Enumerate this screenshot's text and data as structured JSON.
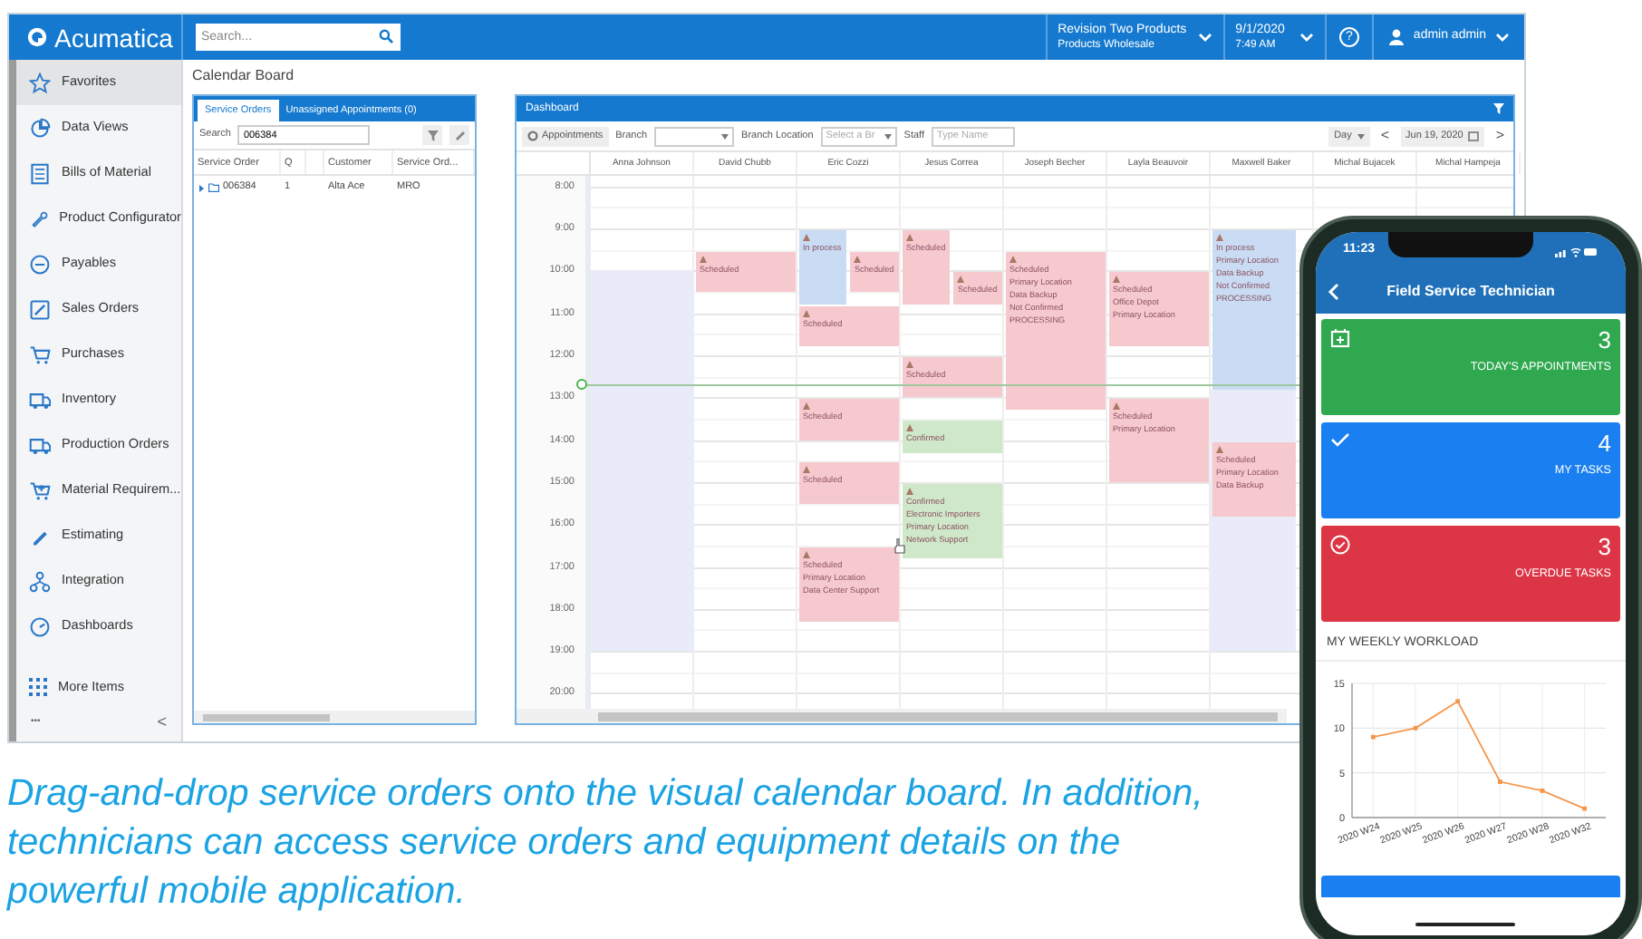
{
  "top_bar": {
    "logo": "Acumatica",
    "search": {
      "placeholder": "Search..."
    },
    "company": {
      "line1": "Revision Two Products",
      "line2": "Products Wholesale"
    },
    "date": {
      "line1": "9/1/2020",
      "line2": "7:49 AM"
    },
    "help": "?",
    "user": "admin admin"
  },
  "sidebar": {
    "items": [
      {
        "label": "Favorites",
        "selected": true
      },
      {
        "label": "Data Views",
        "selected": false
      },
      {
        "label": "Bills of Material",
        "selected": false
      },
      {
        "label": "Product Configurator",
        "selected": false
      },
      {
        "label": "Payables",
        "selected": false
      },
      {
        "label": "Sales Orders",
        "selected": false
      },
      {
        "label": "Purchases",
        "selected": false
      },
      {
        "label": "Inventory",
        "selected": false
      },
      {
        "label": "Production Orders",
        "selected": false
      },
      {
        "label": "Material Requirem...",
        "selected": false
      },
      {
        "label": "Estimating",
        "selected": false
      },
      {
        "label": "Integration",
        "selected": false
      },
      {
        "label": "Dashboards",
        "selected": false
      }
    ],
    "more": "More Items",
    "dots": "•••",
    "collapse": "<"
  },
  "page_title": "Calendar Board",
  "orders_panel": {
    "tabs": [
      {
        "label": "Service Orders",
        "selected": true
      },
      {
        "label": "Unassigned Appointments (0)",
        "selected": false
      }
    ],
    "search_label": "Search",
    "search_value": "006384",
    "columns": [
      "Service Order",
      "Q",
      "",
      "Customer",
      "Service Ord..."
    ],
    "rows": [
      {
        "cells": [
          "006384",
          "1",
          "",
          "Alta Ace",
          "MRO"
        ],
        "expanded": false
      }
    ]
  },
  "calendar": {
    "title": "Dashboard",
    "toolbar": {
      "appointments": "Appointments",
      "branch_label": "Branch",
      "branch_location_label": "Branch Location",
      "branch_location_placeholder": "Select a Br",
      "staff_label": "Staff",
      "staff_placeholder": "Type Name",
      "view": "Day",
      "prev": "<",
      "date": "Jun 19, 2020",
      "next": ">"
    },
    "hours": [
      "8:00",
      "9:00",
      "10:00",
      "11:00",
      "12:00",
      "13:00",
      "14:00",
      "15:00",
      "16:00",
      "17:00",
      "18:00",
      "19:00",
      "20:00"
    ],
    "staff": [
      {
        "name": "Anna Johnson"
      },
      {
        "name": "David Chubb",
        "appointments": [
          {
            "color": "#f6c9cf",
            "lines": [
              "Scheduled"
            ]
          }
        ]
      },
      {
        "name": "Eric Cozzi",
        "appointments": [
          {
            "color": "#c9dcf3",
            "lines": [
              "In process"
            ]
          },
          {
            "color": "#f6c9cf",
            "lines": [
              "Scheduled"
            ]
          },
          {
            "color": "#f6c9cf",
            "lines": [
              "Scheduled"
            ]
          },
          {
            "color": "#f6c9cf",
            "lines": [
              "Scheduled"
            ]
          },
          {
            "color": "#f6c9cf",
            "lines": [
              "Scheduled"
            ]
          },
          {
            "color": "#f6c9cf",
            "lines": [
              "Scheduled",
              "Primary Location",
              "Data Center Support"
            ]
          }
        ]
      },
      {
        "name": "Jesus Correa",
        "appointments": [
          {
            "color": "#f6c9cf",
            "lines": [
              "Scheduled"
            ]
          },
          {
            "color": "#f6c9cf",
            "lines": [
              "Scheduled"
            ]
          },
          {
            "color": "#f6c9cf",
            "lines": [
              "Scheduled"
            ]
          },
          {
            "color": "#cfe8c9",
            "lines": [
              "Confirmed"
            ]
          },
          {
            "color": "#cfe8c9",
            "lines": [
              "Confirmed",
              "Electronic Importers",
              "Primary Location",
              "Network Support"
            ]
          }
        ]
      },
      {
        "name": "Joseph Becher",
        "appointments": [
          {
            "color": "#f6c9cf",
            "lines": [
              "Scheduled",
              "Primary Location",
              "Data Backup",
              "Not Confirmed",
              "PROCESSING"
            ]
          }
        ]
      },
      {
        "name": "Layla Beauvoir",
        "appointments": [
          {
            "color": "#f6c9cf",
            "lines": [
              "Scheduled",
              "Office Depot",
              "Primary Location"
            ]
          },
          {
            "color": "#f6c9cf",
            "lines": [
              "Scheduled",
              "Primary Location"
            ]
          }
        ]
      },
      {
        "name": "Maxwell Baker",
        "appointments": [
          {
            "color": "#c9dcf3",
            "lines": [
              "In process",
              "Primary Location",
              "Data Backup",
              "Not Confirmed",
              "PROCESSING"
            ]
          },
          {
            "color": "#f6c9cf",
            "lines": [
              "Scheduled",
              "Primary Location",
              "Data Backup"
            ]
          }
        ]
      },
      {
        "name": "Michal Bujacek"
      },
      {
        "name": "Michal Hampeja"
      }
    ]
  },
  "phone": {
    "time": "11:23",
    "title": "Field Service Technician",
    "tiles": [
      {
        "count": "3",
        "label": "TODAY'S APPOINTMENTS",
        "color": "#2fa84f",
        "kind": "calendar"
      },
      {
        "count": "4",
        "label": "MY TASKS",
        "color": "#1a7ff0",
        "kind": "check"
      },
      {
        "count": "3",
        "label": "OVERDUE TASKS",
        "color": "#dc3545",
        "kind": "circle-check"
      }
    ],
    "workload_title": "MY WEEKLY WORKLOAD",
    "chart_data": {
      "type": "line",
      "categories": [
        "2020 W24",
        "2020 W25",
        "2020 W26",
        "2020 W27",
        "2020 W28",
        "2020 W32"
      ],
      "series": [
        {
          "color": "#f7964a",
          "marker": true,
          "values": [
            9,
            10,
            13,
            4,
            3,
            1
          ]
        }
      ],
      "ylim": [
        0,
        15
      ],
      "yticks": [
        0,
        5,
        10,
        15
      ]
    }
  },
  "caption": "Drag-and-drop service orders onto the visual calendar board. In addition, technicians can access service orders and equipment details on the powerful mobile application."
}
